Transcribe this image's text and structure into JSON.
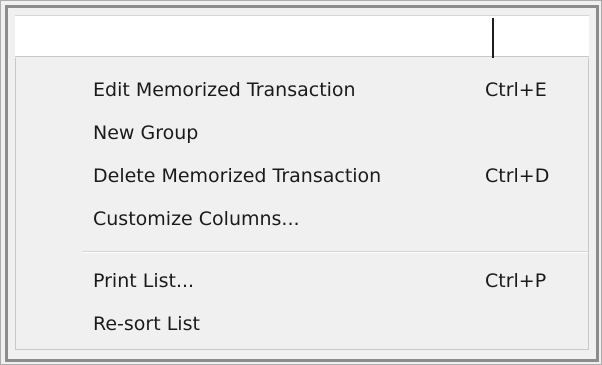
{
  "menu": {
    "items": [
      {
        "label": "Edit Memorized Transaction",
        "shortcut": "Ctrl+E"
      },
      {
        "label": "New Group",
        "shortcut": ""
      },
      {
        "label": "Delete Memorized Transaction",
        "shortcut": "Ctrl+D"
      },
      {
        "label": "Customize Columns...",
        "shortcut": ""
      },
      {
        "label": "Print List...",
        "shortcut": "Ctrl+P"
      },
      {
        "label": "Re-sort List",
        "shortcut": ""
      }
    ]
  }
}
